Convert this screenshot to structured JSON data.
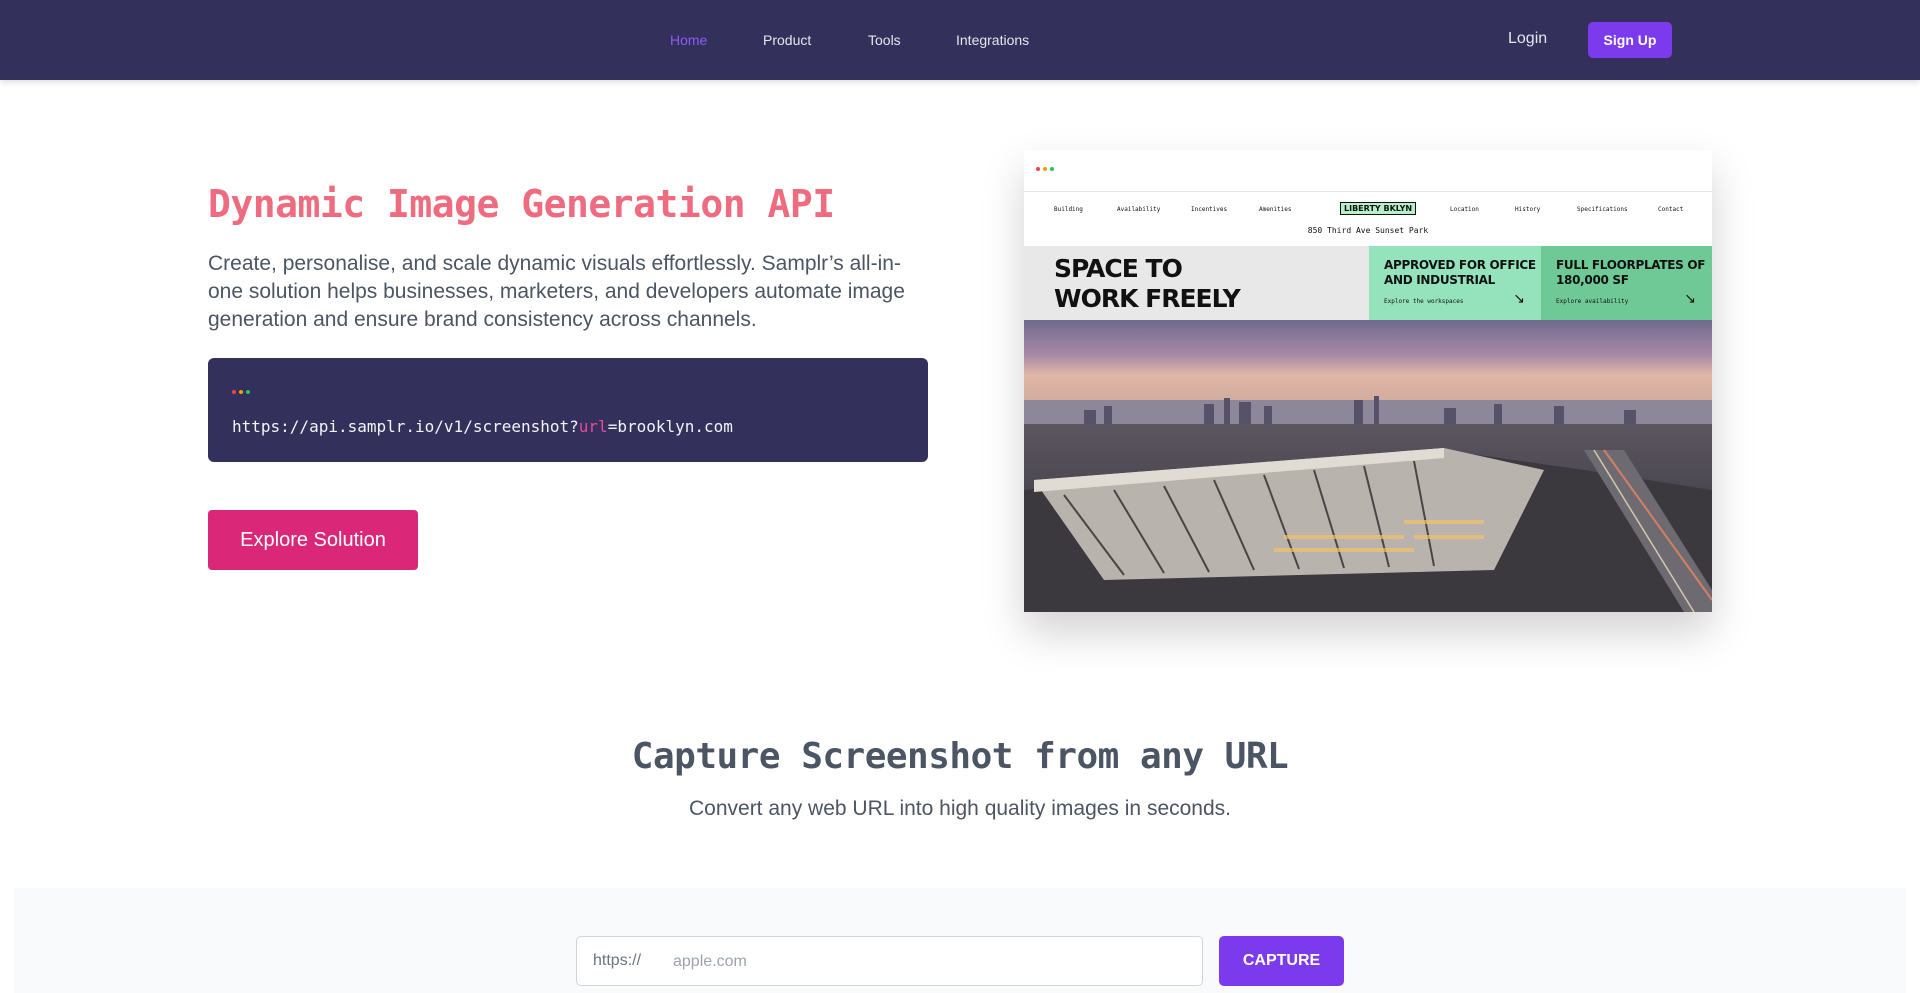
{
  "header": {
    "nav": [
      {
        "label": "Home",
        "active": true
      },
      {
        "label": "Product",
        "active": false
      },
      {
        "label": "Tools",
        "active": false
      },
      {
        "label": "Integrations",
        "active": false
      }
    ],
    "login_label": "Login",
    "signup_label": "Sign Up"
  },
  "hero": {
    "title": "Dynamic Image Generation API",
    "description": "Create, personalise, and scale dynamic visuals effortlessly. Samplr’s all-in-one solution helps businesses, marketers, and developers automate image generation and ensure brand consistency across channels.",
    "code": {
      "prefix": "https://api.samplr.io/v1/screenshot?",
      "param": "url",
      "suffix": "=brooklyn.com"
    },
    "cta_label": "Explore Solution"
  },
  "preview": {
    "nav_items": [
      "Building",
      "Availability",
      "Incentives",
      "Amenities",
      "Location",
      "History",
      "Specifications",
      "Contact"
    ],
    "logo_text": "LIBERTY BKLYN",
    "address": "850 Third Ave Sunset Park",
    "headline_line1": "SPACE TO",
    "headline_line2": "WORK FREELY",
    "card1_title_line1": "APPROVED FOR OFFICE",
    "card1_title_line2": "AND INDUSTRIAL",
    "card1_link": "Explore the workspaces",
    "card2_title_line1": "FULL FLOORPLATES OF",
    "card2_title_line2": "180,000 SF",
    "card2_link": "Explore availability",
    "arrow_icon": "arrow-down-right-icon"
  },
  "capture": {
    "title": "Capture Screenshot from any URL",
    "subtitle": "Convert any web URL into high quality images in seconds.",
    "prefix": "https://",
    "placeholder": "apple.com",
    "button_label": "CAPTURE"
  },
  "colors": {
    "header_bg": "#33305c",
    "accent_purple": "#7c3aed",
    "hero_title": "#ef6b7f",
    "cta_pink": "#db2777",
    "code_param": "#ec4899"
  }
}
